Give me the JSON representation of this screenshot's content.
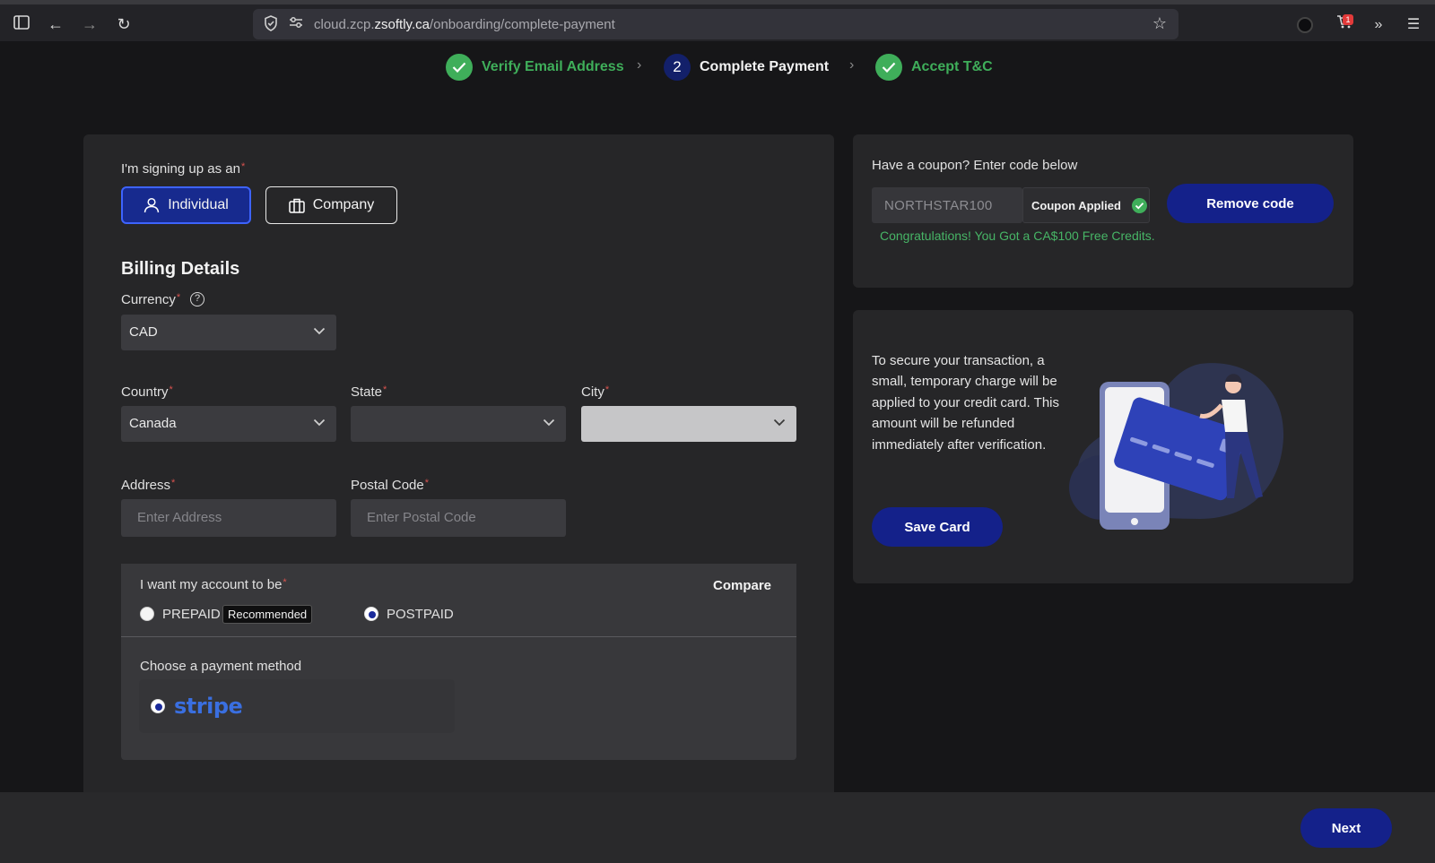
{
  "browser": {
    "url_prefix": "cloud.zcp.",
    "url_domain": "zsoftly.ca",
    "url_path": "/onboarding/complete-payment",
    "extension_badge": "1"
  },
  "steps": [
    {
      "label": "Verify Email Address",
      "status": "done"
    },
    {
      "label": "Complete Payment",
      "number": "2",
      "status": "current"
    },
    {
      "label": "Accept T&C",
      "status": "done"
    }
  ],
  "signup": {
    "label": "I'm signing up as an",
    "individual": "Individual",
    "company": "Company",
    "selected": "Individual"
  },
  "billing": {
    "heading": "Billing Details",
    "currency_label": "Currency",
    "currency_value": "CAD",
    "country_label": "Country",
    "country_value": "Canada",
    "state_label": "State",
    "state_value": "",
    "city_label": "City",
    "city_value": "",
    "address_label": "Address",
    "address_placeholder": "Enter Address",
    "postal_label": "Postal Code",
    "postal_placeholder": "Enter Postal Code"
  },
  "account": {
    "label": "I want my account to be",
    "compare": "Compare",
    "prepaid": "PREPAID",
    "recommended": "Recommended",
    "postpaid": "POSTPAID",
    "selected": "POSTPAID"
  },
  "payment": {
    "label": "Choose a payment method",
    "method": "stripe"
  },
  "coupon": {
    "title": "Have a coupon? Enter code below",
    "code": "NORTHSTAR100",
    "status": "Coupon Applied",
    "remove": "Remove code",
    "message": "Congratulations! You Got a CA$100 Free Credits."
  },
  "card": {
    "text": "To secure your transaction, a small, temporary charge will be applied to your credit card. This amount will be refunded immediately after verification.",
    "save": "Save Card"
  },
  "footer": {
    "next": "Next"
  },
  "colors": {
    "accent": "#14218a",
    "success": "#3fae5a",
    "required": "#d9534f",
    "stripe": "#3a6fe0"
  }
}
